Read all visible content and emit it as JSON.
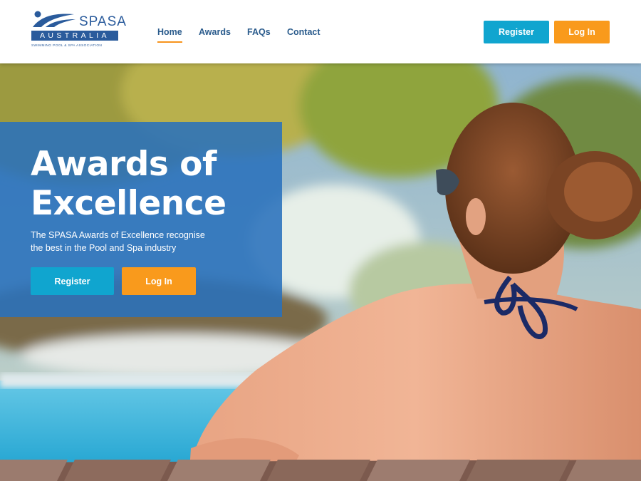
{
  "brand": {
    "name": "SPASA",
    "country": "AUSTRALIA",
    "tagline": "SWIMMING POOL & SPA ASSOCIATION",
    "color": "#2a5b9c"
  },
  "nav": {
    "items": [
      {
        "label": "Home",
        "active": true
      },
      {
        "label": "Awards",
        "active": false
      },
      {
        "label": "FAQs",
        "active": false
      },
      {
        "label": "Contact",
        "active": false
      }
    ]
  },
  "header_actions": {
    "register_label": "Register",
    "login_label": "Log In"
  },
  "hero": {
    "title_line1": "Awards of",
    "title_line2": "Excellence",
    "subtitle_line1": "The SPASA Awards of Excellence recognise",
    "subtitle_line2": "the best in the Pool and Spa industry",
    "register_label": "Register",
    "login_label": "Log In"
  },
  "colors": {
    "accent_teal": "#10a5cf",
    "accent_orange": "#f99a1c",
    "card_blue": "#2971bc",
    "nav_text": "#2a5b8c"
  }
}
